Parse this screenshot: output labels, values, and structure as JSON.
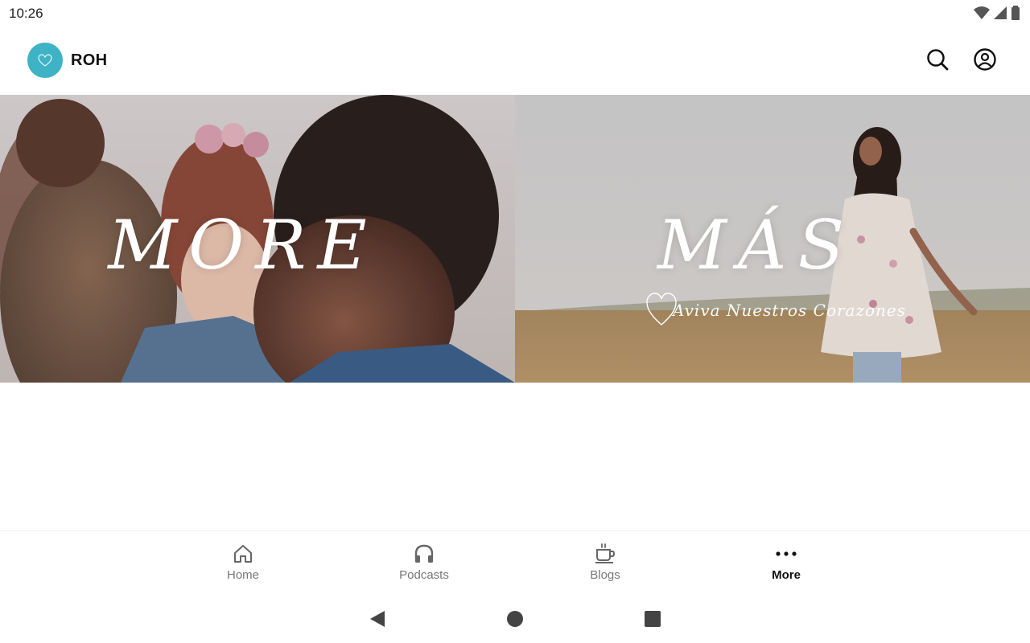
{
  "status": {
    "time": "10:26"
  },
  "header": {
    "title": "ROH",
    "logo": "heart-logo",
    "colors": {
      "logo_bg": "#3db3c5"
    }
  },
  "banners": [
    {
      "title": "MORE",
      "subtitle": ""
    },
    {
      "title": "MÁS",
      "subtitle": "Aviva Nuestros Corazones"
    }
  ],
  "bottom_nav": {
    "items": [
      {
        "label": "Home",
        "icon": "home-icon",
        "active": false
      },
      {
        "label": "Podcasts",
        "icon": "headphones-icon",
        "active": false
      },
      {
        "label": "Blogs",
        "icon": "coffee-cup-icon",
        "active": false
      },
      {
        "label": "More",
        "icon": "more-dots-icon",
        "active": true
      }
    ]
  }
}
